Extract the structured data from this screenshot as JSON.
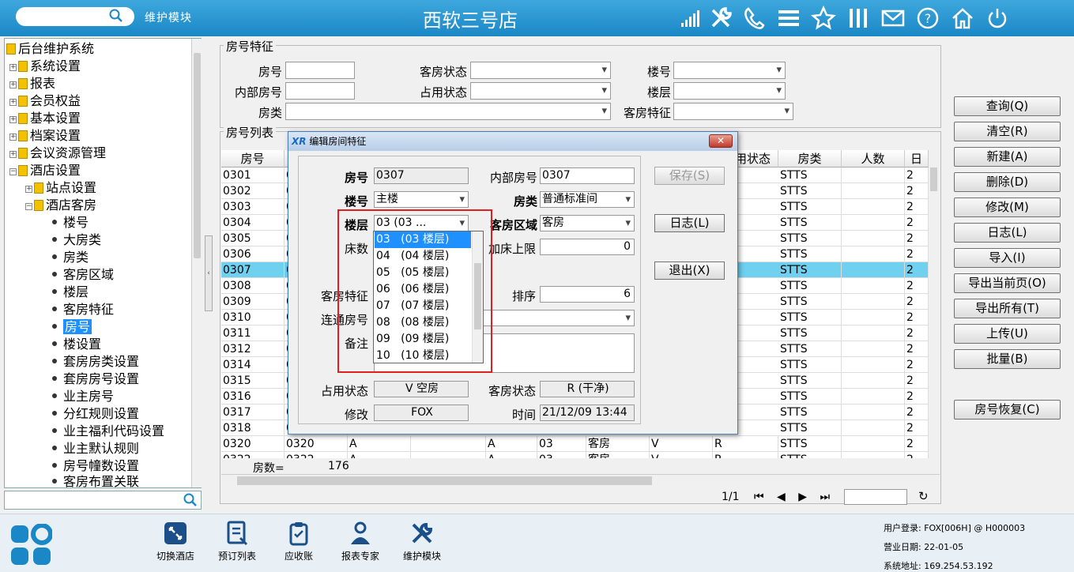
{
  "topbar": {
    "module_name": "维护模块",
    "store_title": "西软三号店",
    "icons": [
      "signal-icon",
      "tools-icon",
      "phone-icon",
      "menu-icon",
      "star-icon",
      "columns-icon",
      "mail-icon",
      "help-icon",
      "home-icon",
      "power-icon"
    ]
  },
  "tree": {
    "items": [
      {
        "label": "后台维护系统",
        "type": "root"
      },
      {
        "label": "系统设置",
        "type": "folder"
      },
      {
        "label": "报表",
        "type": "folder"
      },
      {
        "label": "会员权益",
        "type": "folder"
      },
      {
        "label": "基本设置",
        "type": "folder"
      },
      {
        "label": "档案设置",
        "type": "folder"
      },
      {
        "label": "会议资源管理",
        "type": "folder"
      },
      {
        "label": "酒店设置",
        "type": "folder-open"
      },
      {
        "label": "站点设置",
        "type": "subfolder"
      },
      {
        "label": "酒店客房",
        "type": "subfolder-open"
      },
      {
        "label": "楼号",
        "type": "leaf"
      },
      {
        "label": "大房类",
        "type": "leaf"
      },
      {
        "label": "房类",
        "type": "leaf"
      },
      {
        "label": "客房区域",
        "type": "leaf"
      },
      {
        "label": "楼层",
        "type": "leaf"
      },
      {
        "label": "客房特征",
        "type": "leaf"
      },
      {
        "label": "房号",
        "type": "leaf-selected"
      },
      {
        "label": "楼设置",
        "type": "leaf"
      },
      {
        "label": "套房房类设置",
        "type": "leaf"
      },
      {
        "label": "套房房号设置",
        "type": "leaf"
      },
      {
        "label": "业主房号",
        "type": "leaf"
      },
      {
        "label": "分红规则设置",
        "type": "leaf"
      },
      {
        "label": "业主福利代码设置",
        "type": "leaf"
      },
      {
        "label": "业主默认规则",
        "type": "leaf"
      },
      {
        "label": "房号幢数设置",
        "type": "leaf"
      },
      {
        "label": "客房布置关联",
        "type": "leaf"
      }
    ]
  },
  "filter": {
    "legend": "房号特征",
    "room_no": "房号",
    "room_status": "客房状态",
    "building": "楼号",
    "internal_no": "内部房号",
    "occupy_status": "占用状态",
    "floor": "楼层",
    "room_type": "房类",
    "room_feature": "客房特征"
  },
  "actions": {
    "query": "查询(Q)",
    "clear": "清空(R)",
    "new": "新建(A)",
    "delete": "删除(D)",
    "modify": "修改(M)",
    "log": "日志(L)",
    "import": "导入(I)",
    "export_page": "导出当前页(O)",
    "export_all": "导出所有(T)",
    "upload": "上传(U)",
    "batch": "批量(B)",
    "restore": "房号恢复(C)"
  },
  "room_list": {
    "legend": "房号列表",
    "headers": {
      "room_no": "房号",
      "status": "占用状态",
      "type": "房类",
      "people": "人数",
      "last": "日"
    },
    "rows": [
      {
        "no": "0301",
        "c1": "0",
        "st": "STTS",
        "n": "2"
      },
      {
        "no": "0302",
        "c1": "0",
        "st": "STTS",
        "n": "2"
      },
      {
        "no": "0303",
        "c1": "0",
        "st": "STTS",
        "n": "2"
      },
      {
        "no": "0304",
        "c1": "0",
        "st": "STTS",
        "n": "2"
      },
      {
        "no": "0305",
        "c1": "0",
        "st": "STTS",
        "n": "2"
      },
      {
        "no": "0306",
        "c1": "0",
        "st": "STTS",
        "n": "2"
      },
      {
        "no": "0307",
        "c1": "0",
        "st": "STTS",
        "n": "2"
      },
      {
        "no": "0308",
        "c1": "0",
        "st": "STTS",
        "n": "2"
      },
      {
        "no": "0309",
        "c1": "0",
        "st": "STTS",
        "n": "2"
      },
      {
        "no": "0310",
        "c1": "0",
        "st": "STTS",
        "n": "2"
      },
      {
        "no": "0311",
        "c1": "0",
        "st": "STTS",
        "n": "2"
      },
      {
        "no": "0312",
        "c1": "0",
        "st": "STTS",
        "n": "2"
      },
      {
        "no": "0314",
        "c1": "0",
        "st": "STTS",
        "n": "2"
      },
      {
        "no": "0315",
        "c1": "0",
        "st": "STTS",
        "n": "2"
      },
      {
        "no": "0316",
        "c1": "0",
        "st": "STTS",
        "n": "2"
      },
      {
        "no": "0317",
        "c1": "0",
        "st": "STTS",
        "n": "2"
      },
      {
        "no": "0318",
        "c1": "0",
        "st": "STTS",
        "n": "2"
      }
    ],
    "row_0320": {
      "no": "0320",
      "internal": "0320",
      "a1": "A",
      "a2": "A",
      "floor": "03",
      "area": "客房",
      "v": "V",
      "r": "R",
      "st": "STTS",
      "n": "2"
    },
    "row_partial": {
      "no": "0322",
      "internal": "0322",
      "a1": "A",
      "a2": "A",
      "floor": "03",
      "area": "客房",
      "v": "V",
      "r": "R",
      "st": "STTS",
      "n": "2"
    },
    "count_label": "房数=",
    "count_value": "176",
    "pager": "1/1"
  },
  "dialog": {
    "title": "编辑房间特征",
    "room_no_label": "房号",
    "room_no": "0307",
    "internal_label": "内部房号",
    "internal": "0307",
    "building_label": "楼号",
    "building": "主楼",
    "type_label": "房类",
    "type": "普通标准间",
    "floor_label": "楼层",
    "floor": "03   (03 ...",
    "area_label": "客房区域",
    "area": "客房",
    "beds_label": "床数",
    "extra_bed_label": "加床上限",
    "extra_bed": "0",
    "feature_label": "客房特征",
    "sort_label": "排序",
    "sort": "6",
    "connected_label": "连通房号",
    "remark_label": "备注",
    "occupy_label": "占用状态",
    "occupy": "V   空房",
    "status_label": "客房状态",
    "status": "R   (干净)",
    "modify_label": "修改",
    "modify_by": "FOX",
    "time_label": "时间",
    "time": "21/12/09 13:44",
    "save": "保存(S)",
    "log": "日志(L)",
    "exit": "退出(X)",
    "floor_options": [
      "03   (03 楼层)",
      "04   (04 楼层)",
      "05   (05 楼层)",
      "06   (06 楼层)",
      "07   (07 楼层)",
      "08   (08 楼层)",
      "09   (09 楼层)",
      "10   (10 楼层)"
    ]
  },
  "bottom": {
    "buttons": [
      "切换酒店",
      "预订列表",
      "应收账",
      "报表专家",
      "维护模块"
    ],
    "user_login": "用户登录: FOX[006H] @ H000003",
    "business_date": "营业日期: 22-01-05",
    "system_address": "系统地址: 169.254.53.192"
  }
}
